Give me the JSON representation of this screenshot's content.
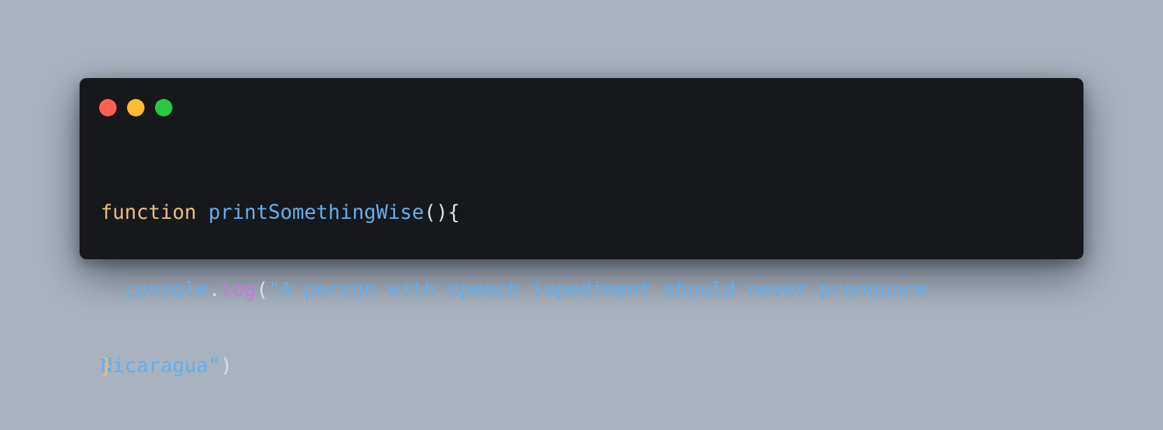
{
  "colors": {
    "background": "#a9b3bf",
    "window": "#17181b",
    "close": "#ff5f57",
    "minimize": "#febc2e",
    "maximize": "#28c840",
    "keyword": "#e5c07b",
    "function_name": "#61afef",
    "punctuation": "#d8dee9",
    "identifier": "#61afef",
    "method": "#c678dd",
    "string": "#61afef"
  },
  "window_controls": {
    "close": "close-button",
    "minimize": "minimize-button",
    "maximize": "maximize-button"
  },
  "code": {
    "line1": {
      "keyword": "function",
      "name": "printSomethingWise",
      "punct": "(){"
    },
    "line2": {
      "indent": "  ",
      "object": "console",
      "dot": ".",
      "method": "log",
      "open_paren": "(",
      "string_part": "\"A person with speech impediment should never pronounce"
    },
    "line3": {
      "closing_brace": "}",
      "string_rest": "Nicaragua\"",
      "close_paren": ")"
    }
  }
}
